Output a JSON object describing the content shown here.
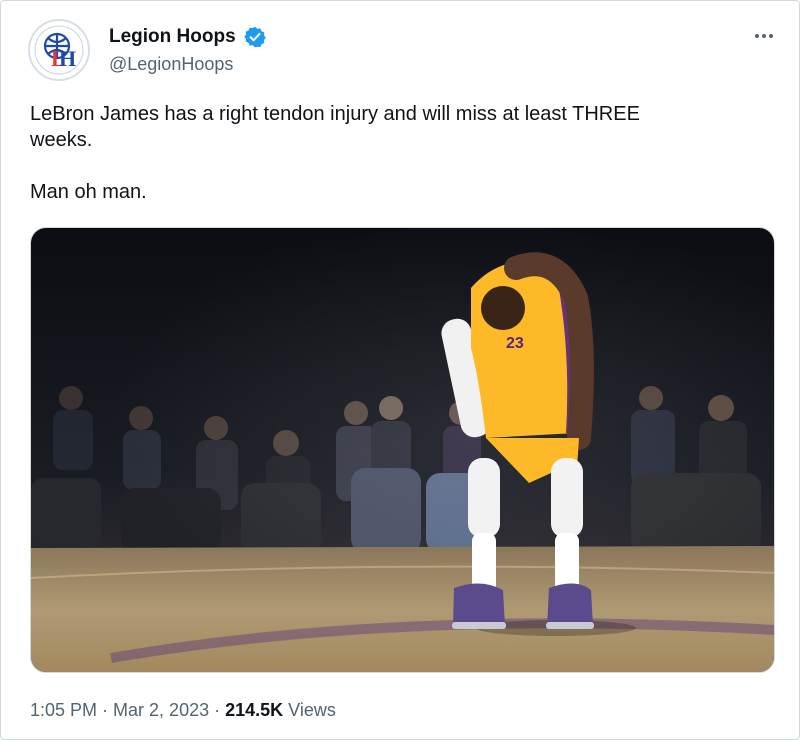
{
  "author": {
    "display_name": "Legion Hoops",
    "handle": "@LegionHoops",
    "avatar_monogram": "LH",
    "verified": true,
    "avatar_icon": "legion-hoops-logo"
  },
  "tweet": {
    "text": "LeBron James has a right tendon injury and will miss at least THREE\nweeks.\n\nMan oh man.",
    "media_alt_icon": "photo"
  },
  "meta": {
    "time": "1:05 PM",
    "separator1": " · ",
    "date": "Mar 2, 2023",
    "separator2": " · ",
    "views_count": "214.5K",
    "views_label": " Views"
  },
  "colors": {
    "verified_blue": "#1d9bf0",
    "text_primary": "#0f1419",
    "text_secondary": "#536471",
    "lakers_gold": "#fdb927",
    "lakers_purple": "#552583"
  }
}
